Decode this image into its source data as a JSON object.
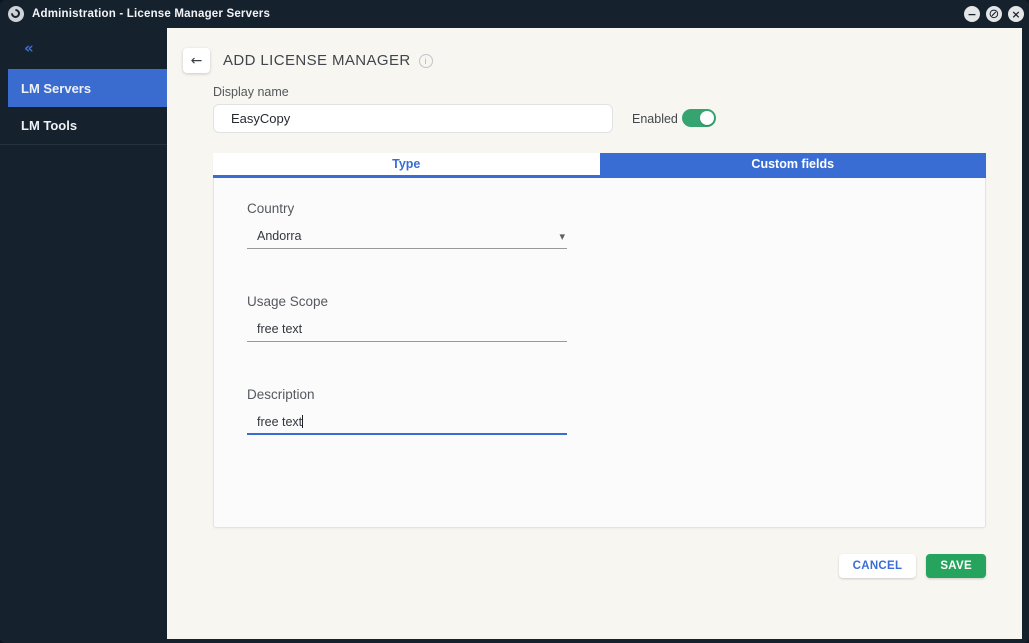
{
  "window": {
    "title": "Administration - License Manager Servers"
  },
  "icons": {
    "minimize": "−",
    "blocked": "⊘",
    "close": "×",
    "back": "←",
    "info": "i",
    "collapse": "«",
    "dropdown": "▾"
  },
  "sidebar": {
    "items": [
      {
        "label": "LM Servers",
        "active": true
      },
      {
        "label": "LM Tools",
        "active": false
      }
    ]
  },
  "header": {
    "title": "ADD LICENSE MANAGER"
  },
  "form": {
    "display_name": {
      "label": "Display name",
      "value": "EasyCopy"
    },
    "enabled": {
      "label": "Enabled",
      "state": "on"
    },
    "tabs": [
      {
        "label": "Type",
        "active": false
      },
      {
        "label": "Custom fields",
        "active": true
      }
    ],
    "fields": [
      {
        "label": "Country",
        "value": "Andorra",
        "type": "select"
      },
      {
        "label": "Usage Scope",
        "value": "free text",
        "type": "text"
      },
      {
        "label": "Description",
        "value": "free text",
        "type": "text",
        "focused": true
      }
    ]
  },
  "actions": {
    "cancel": "CANCEL",
    "save": "SAVE"
  },
  "colors": {
    "titlebar": "#16212e",
    "accent_blue": "#3a6dd4",
    "toggle_green": "#36a471",
    "save_green": "#26a35d",
    "main_background": "#f8f6f1",
    "panel_background": "#fbfbfc"
  }
}
